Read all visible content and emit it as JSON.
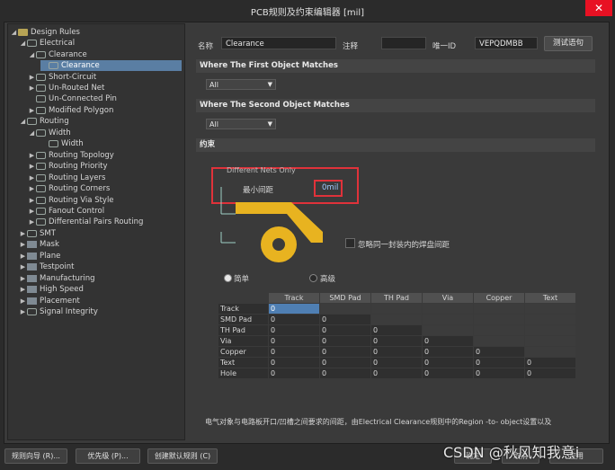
{
  "window": {
    "title": "PCB规则及约束编辑器 [mil]",
    "close_glyph": "✕"
  },
  "tree": {
    "items": [
      {
        "label": "Design Rules",
        "arrow": "◢"
      },
      {
        "label": "Electrical",
        "arrow": "◢"
      },
      {
        "label": "Clearance",
        "arrow": "◢"
      },
      {
        "label": "Clearance",
        "arrow": ""
      },
      {
        "label": "Short-Circuit",
        "arrow": "▶"
      },
      {
        "label": "Un-Routed Net",
        "arrow": "▶"
      },
      {
        "label": "Un-Connected Pin",
        "arrow": ""
      },
      {
        "label": "Modified Polygon",
        "arrow": "▶"
      },
      {
        "label": "Routing",
        "arrow": "◢"
      },
      {
        "label": "Width",
        "arrow": "◢"
      },
      {
        "label": "Width",
        "arrow": ""
      },
      {
        "label": "Routing Topology",
        "arrow": "▶"
      },
      {
        "label": "Routing Priority",
        "arrow": "▶"
      },
      {
        "label": "Routing Layers",
        "arrow": "▶"
      },
      {
        "label": "Routing Corners",
        "arrow": "▶"
      },
      {
        "label": "Routing Via Style",
        "arrow": "▶"
      },
      {
        "label": "Fanout Control",
        "arrow": "▶"
      },
      {
        "label": "Differential Pairs Routing",
        "arrow": "▶"
      },
      {
        "label": "SMT",
        "arrow": "▶"
      },
      {
        "label": "Mask",
        "arrow": "▶"
      },
      {
        "label": "Plane",
        "arrow": "▶"
      },
      {
        "label": "Testpoint",
        "arrow": "▶"
      },
      {
        "label": "Manufacturing",
        "arrow": "▶"
      },
      {
        "label": "High Speed",
        "arrow": "▶"
      },
      {
        "label": "Placement",
        "arrow": "▶"
      },
      {
        "label": "Signal Integrity",
        "arrow": "▶"
      }
    ]
  },
  "header": {
    "name_label": "名称",
    "name_value": "Clearance",
    "comment_label": "注释",
    "comment_value": "",
    "uid_label": "唯一ID",
    "uid_value": "VEPQDMBB",
    "test_button": "测试语句"
  },
  "first_match": {
    "title": "Where The First Object Matches",
    "selected": "All"
  },
  "second_match": {
    "title": "Where The Second Object Matches",
    "selected": "All"
  },
  "constraints": {
    "title": "约束",
    "different_nets": "Different Nets Only",
    "min_clearance_label": "最小间距",
    "min_clearance_value": "0mil",
    "ignore_pads_label": "忽略同一封装内的焊盘间距",
    "simple_label": "简单",
    "advanced_label": "高级",
    "description": "电气对象与电路板开口/凹槽之间要求的间距，由Electrical Clearance规则中的Region -to- object设置以及"
  },
  "matrix": {
    "columns": [
      "Track",
      "SMD Pad",
      "TH Pad",
      "Via",
      "Copper",
      "Text"
    ],
    "rows": [
      {
        "label": "Track",
        "values": [
          "0"
        ]
      },
      {
        "label": "SMD Pad",
        "values": [
          "0",
          "0"
        ]
      },
      {
        "label": "TH Pad",
        "values": [
          "0",
          "0",
          "0"
        ]
      },
      {
        "label": "Via",
        "values": [
          "0",
          "0",
          "0",
          "0"
        ]
      },
      {
        "label": "Copper",
        "values": [
          "0",
          "0",
          "0",
          "0",
          "0"
        ]
      },
      {
        "label": "Text",
        "values": [
          "0",
          "0",
          "0",
          "0",
          "0",
          "0"
        ]
      },
      {
        "label": "Hole",
        "values": [
          "0",
          "0",
          "0",
          "0",
          "0",
          "0"
        ]
      }
    ]
  },
  "footer": {
    "wizard_button": "规则向导 (R)...",
    "priority_button": "优先级 (P)...",
    "default_button": "创建默认规则 (C)",
    "ok_button": "确定",
    "cancel_button": "取消",
    "apply_button": "应用"
  },
  "watermark": "CSDN @秋风知我意i",
  "colors": {
    "highlight_red": "#e0323a",
    "copper_yellow": "#e8b320",
    "selection_blue": "#5a7ea3"
  }
}
